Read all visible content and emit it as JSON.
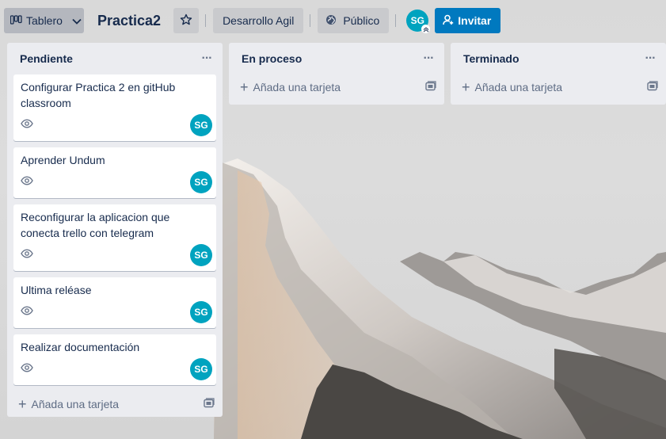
{
  "header": {
    "view_label": "Tablero",
    "board_title": "Practica2",
    "team_label": "Desarrollo Agil",
    "visibility_label": "Público",
    "member_initials": "SG",
    "invite_label": "Invitar"
  },
  "lists": [
    {
      "title": "Pendiente",
      "menu": "···",
      "add_card_label": "Añada una tarjeta",
      "cards": [
        {
          "title": "Configurar Practica 2 en gitHub classroom",
          "member": "SG"
        },
        {
          "title": "Aprender Undum",
          "member": "SG"
        },
        {
          "title": "Reconfigurar la aplicacion que conecta trello con telegram",
          "member": "SG"
        },
        {
          "title": "Ultima reléase",
          "member": "SG"
        },
        {
          "title": "Realizar documentación",
          "member": "SG"
        }
      ]
    },
    {
      "title": "En proceso",
      "menu": "···",
      "add_card_label": "Añada una tarjeta",
      "cards": []
    },
    {
      "title": "Terminado",
      "menu": "···",
      "add_card_label": "Añada una tarjeta",
      "cards": []
    }
  ],
  "colors": {
    "accent": "#0079bf",
    "member_avatar": "#00a3bf",
    "list_bg": "#ebecf0"
  },
  "icons": [
    "board-view-icon",
    "chevron-down-icon",
    "star-icon",
    "globe-icon",
    "add-user-icon",
    "eye-icon",
    "plus-icon",
    "template-card-icon"
  ]
}
